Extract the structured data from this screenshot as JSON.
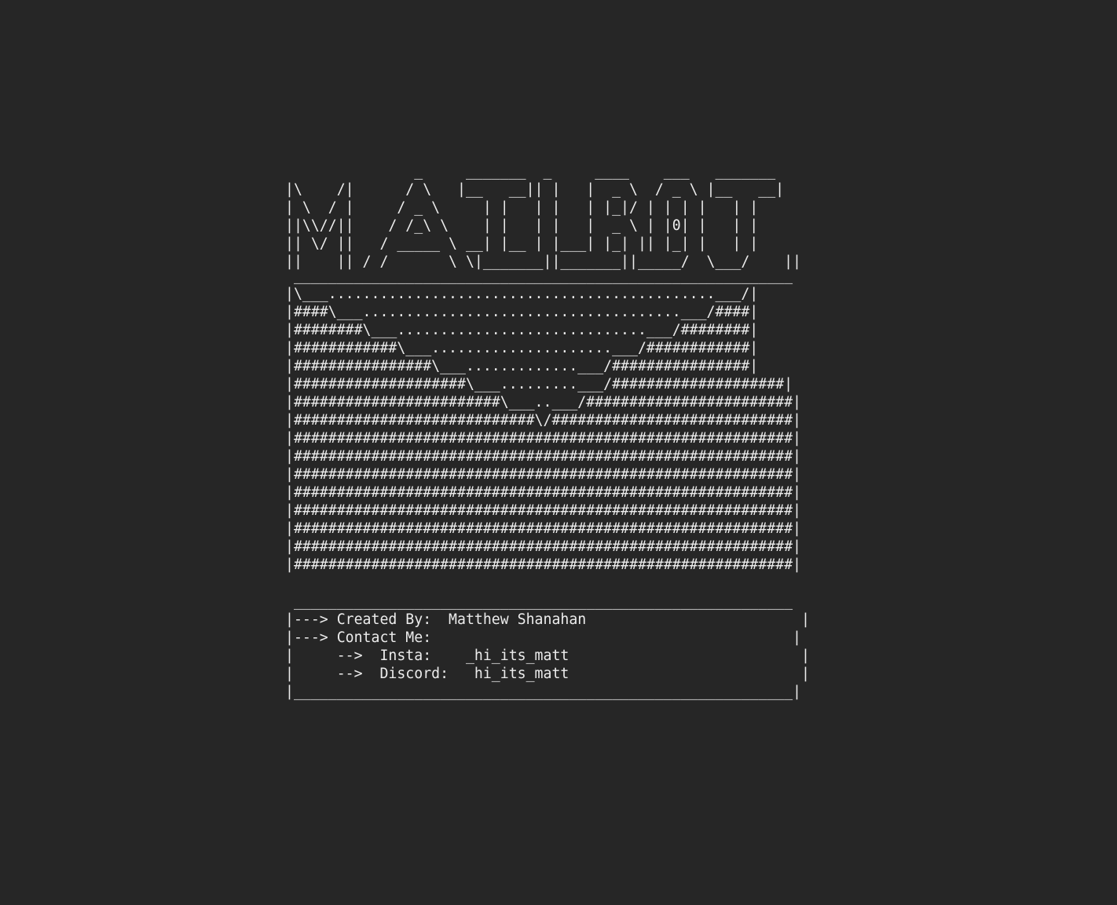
{
  "banner": {
    "lines": [
      "               _     _______  _     ____    ___   _______",
      "|\\    /|      / \\   |__   __|| |   |  _ \\  / _ \\ |__   __|",
      "| \\  / |     / _ \\     | |   | |   | |_|/ | | | |   | |",
      "||\\\\//||    / /_\\ \\    | |   | |   |  _ \\ | |0| |   | |",
      "|| \\/ ||   / _____ \\ __| |__ | |___| |_| || |_| |   | |",
      "||    || / /       \\ \\|_______||_______||_____/  \\___/    ||"
    ]
  },
  "envelope": {
    "lines": [
      " __________________________________________________________",
      "|\\___.............................................___/|",
      "|####\\___.....................................___/####|",
      "|########\\___.............................___/########|",
      "|############\\___.....................___/############|",
      "|################\\___.............___/################|",
      "|####################\\___.........___/####################|",
      "|########################\\___..___/########################|",
      "|############################\\/############################|",
      "|##########################################################|",
      "|##########################################################|",
      "|##########################################################|",
      "|##########################################################|",
      "|##########################################################|",
      "|##########################################################|",
      "|##########################################################|",
      "|##########################################################|"
    ]
  },
  "credits": {
    "top_border": " __________________________________________________________",
    "created_by": "|---> Created By:  Matthew Shanahan                         |",
    "contact_me": "|---> Contact Me:                                          |",
    "insta": "|     -->  Insta:    _hi_its_matt                           |",
    "discord": "|     -->  Discord:   hi_its_matt                           |",
    "bottom_border": "|__________________________________________________________|"
  }
}
